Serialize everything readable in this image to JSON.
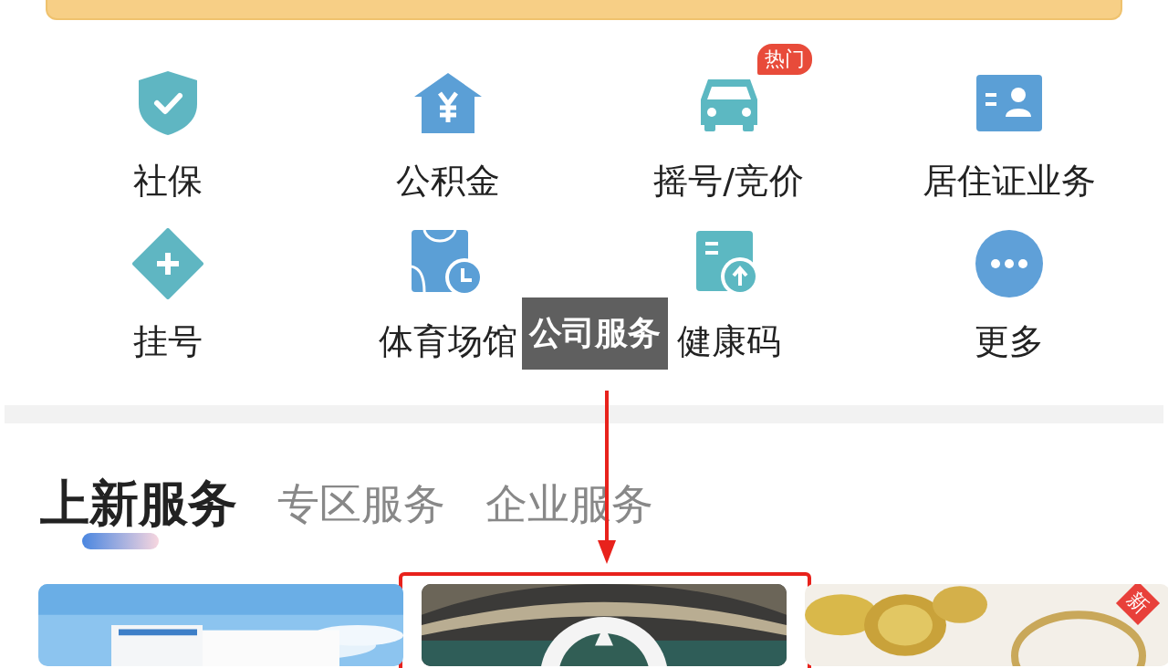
{
  "services": [
    {
      "label": "社保",
      "kind": "shield"
    },
    {
      "label": "公积金",
      "kind": "house"
    },
    {
      "label": "摇号/竞价",
      "kind": "car",
      "badge": "热门"
    },
    {
      "label": "居住证业务",
      "kind": "idcard"
    },
    {
      "label": "挂号",
      "kind": "plus"
    },
    {
      "label": "体育场馆",
      "kind": "venue"
    },
    {
      "label": "健康码",
      "kind": "upload"
    },
    {
      "label": "更多",
      "kind": "more"
    }
  ],
  "annotation": {
    "label": "公司服务"
  },
  "tabs": [
    {
      "label": "上新服务",
      "selected": true
    },
    {
      "label": "专区服务",
      "selected": false
    },
    {
      "label": "企业服务",
      "selected": false
    }
  ],
  "cards": [
    {
      "kind": "truck"
    },
    {
      "kind": "stadium"
    },
    {
      "kind": "coins",
      "badge": "新"
    }
  ]
}
